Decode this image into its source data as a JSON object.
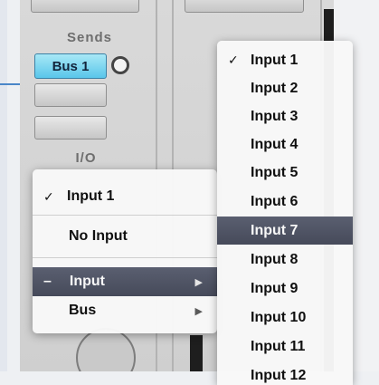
{
  "mixer": {
    "sends_label": "Sends",
    "send_slot_value": "Bus 1",
    "io_label": "I/O"
  },
  "io_menu": {
    "check_mark": "✓",
    "items": [
      {
        "label": "Input 1",
        "checked": true
      },
      {
        "label": "No Input"
      },
      {
        "label": "Input",
        "prefix": "–",
        "submenu": true,
        "highlighted": true
      },
      {
        "label": "Bus",
        "submenu": true
      }
    ],
    "submenu_arrow": "▶"
  },
  "input_submenu": {
    "check_mark": "✓",
    "items": [
      "Input 1",
      "Input 2",
      "Input 3",
      "Input 4",
      "Input 5",
      "Input 6",
      "Input 7",
      "Input 8",
      "Input 9",
      "Input 10",
      "Input 11",
      "Input 12"
    ],
    "checked_item": "Input 1",
    "highlighted_item": "Input 7"
  },
  "colors": {
    "bus_button": "#59c6ea",
    "menu_highlight": "#4f5464",
    "accent_rule": "#4a86c8"
  }
}
